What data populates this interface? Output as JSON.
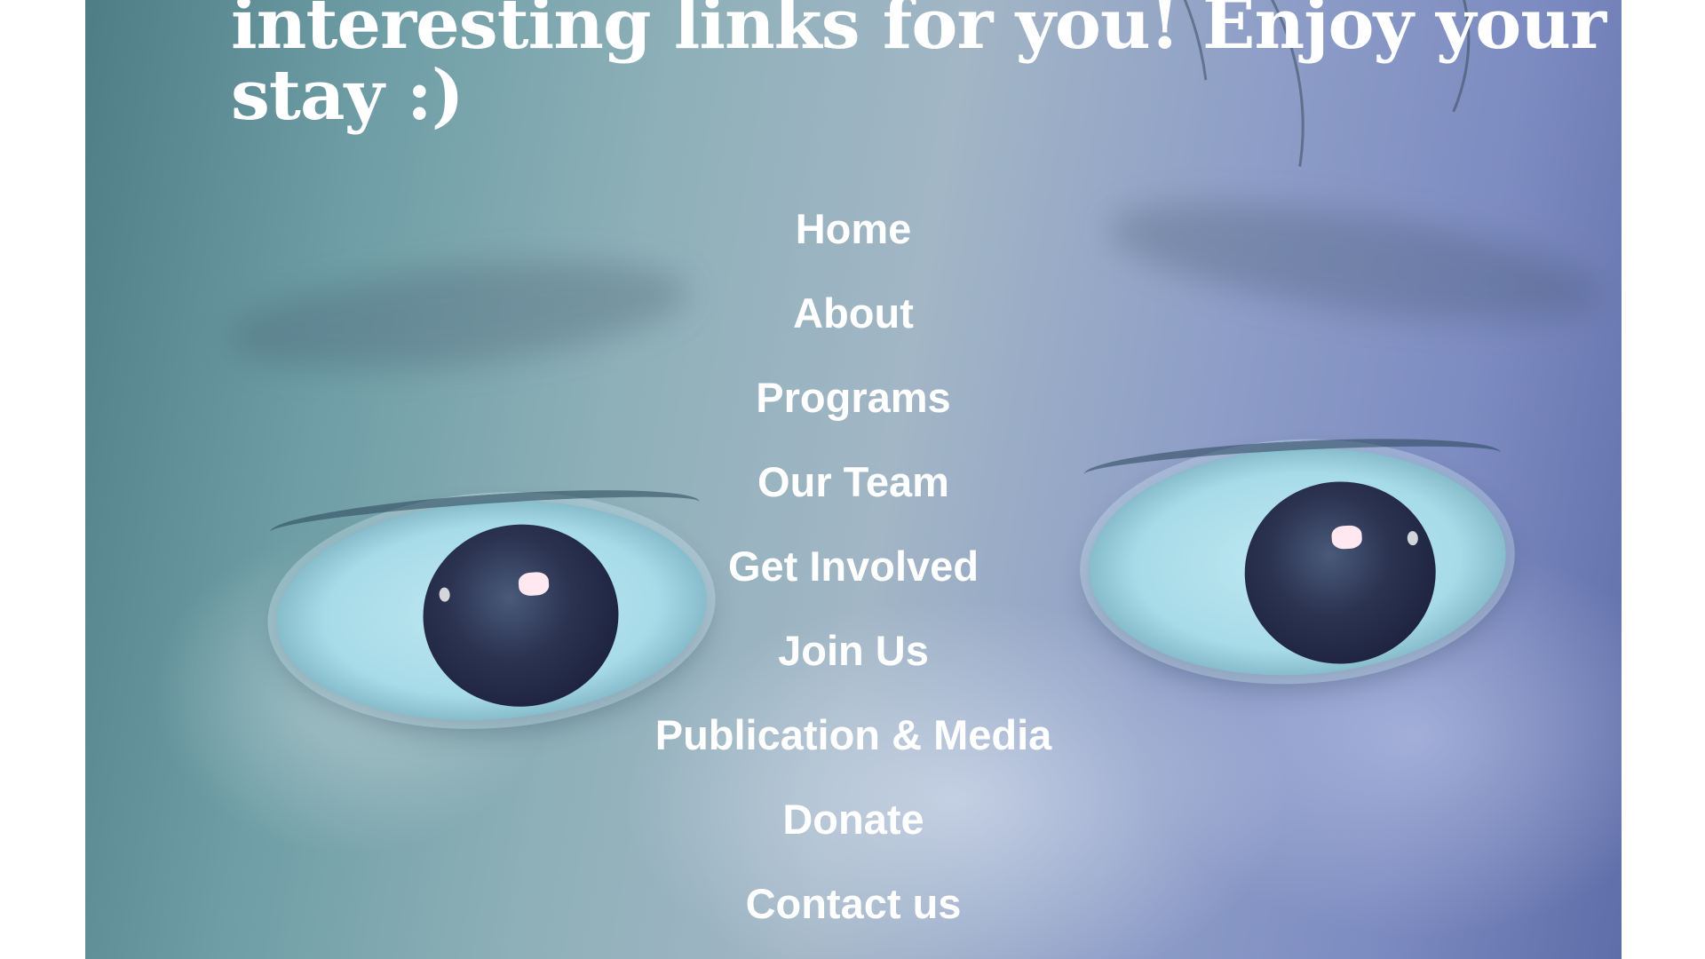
{
  "hero": {
    "headline": "interesting links for you! Enjoy your stay :)",
    "background_colors": {
      "left": "#4f7d86",
      "center": "#a2b6c6",
      "right": "#5f6da8",
      "text": "#ffffff"
    }
  },
  "nav": {
    "items": [
      {
        "label": "Home"
      },
      {
        "label": "About"
      },
      {
        "label": "Programs"
      },
      {
        "label": "Our Team"
      },
      {
        "label": "Get Involved"
      },
      {
        "label": "Join Us"
      },
      {
        "label": "Publication & Media"
      },
      {
        "label": "Donate"
      },
      {
        "label": "Contact us"
      }
    ]
  }
}
